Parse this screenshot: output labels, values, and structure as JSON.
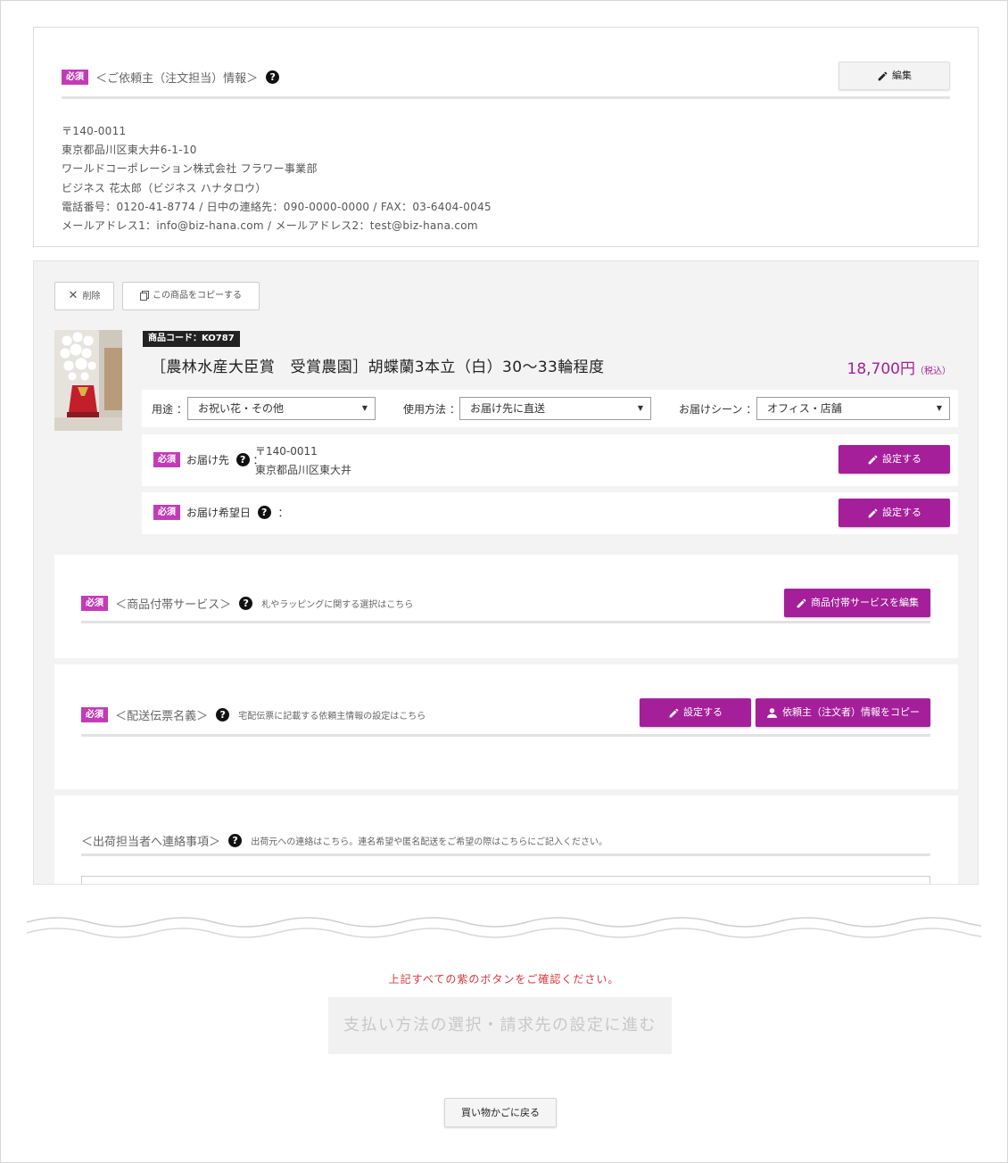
{
  "requester": {
    "badge": "必須",
    "title": "＜ご依頼主（注文担当）情報＞",
    "help": "?",
    "edit_label": "編集",
    "lines": [
      "〒140-0011",
      "東京都品川区東大井6-1-10",
      "ワールドコーポレーション株式会社 フラワー事業部",
      "ビジネス 花太郎（ビジネス ハナタロウ）",
      "電話番号：0120-41-8774 / 日中の連絡先：090-0000-0000 / FAX：03-6404-0045",
      "メールアドレス1：info@biz-hana.com / メールアドレス2：test@biz-hana.com"
    ]
  },
  "product": {
    "delete_label": "削除",
    "copy_label": "この商品をコピーする",
    "code": "商品コード：KO787",
    "name": "［農林水産大臣賞　受賞農園］胡蝶蘭3本立（白）30～33輪程度",
    "price": "18,700円",
    "tax": "（税込）",
    "selects": [
      {
        "label": "用途 ：",
        "value": "お祝い花・その他"
      },
      {
        "label": "使用方法 ：",
        "value": "お届け先に直送"
      },
      {
        "label": "お届けシーン ：",
        "value": "オフィス・店舗"
      }
    ],
    "delivery": {
      "badge": "必須",
      "label": "お届け先",
      "colon": "：",
      "postal": "〒140-0011",
      "address": "東京都品川区東大井",
      "button": "設定する"
    },
    "date": {
      "badge": "必須",
      "label": "お届け希望日",
      "colon": "：",
      "button": "設定する"
    }
  },
  "services": {
    "badge": "必須",
    "title": "＜商品付帯サービス＞",
    "hint": "札やラッピングに関する選択はこちら",
    "button": "商品付帯サービスを編集"
  },
  "slip": {
    "badge": "必須",
    "title": "＜配送伝票名義＞",
    "hint": "宅配伝票に記載する依頼主情報の設定はこちら",
    "set_button": "設定する",
    "copy_button": "依頼主（注文者）情報をコピー"
  },
  "contact": {
    "title": "＜出荷担当者へ連絡事項＞",
    "hint": "出荷元への連絡はこちら。連名希望や匿名配送をご希望の際はこちらにご記入ください。"
  },
  "footer": {
    "notice": "上記すべての紫のボタンをご確認ください。",
    "proceed": "支払い方法の選択・請求先の設定に進む",
    "back": "買い物かごに戻る"
  },
  "colors": {
    "accent": "#a41f99",
    "badge": "#c23cb5",
    "notice": "#d8393b"
  },
  "icons": [
    "pencil-icon",
    "help-icon",
    "close-icon",
    "copy-icon",
    "user-icon",
    "caret-down-icon"
  ]
}
